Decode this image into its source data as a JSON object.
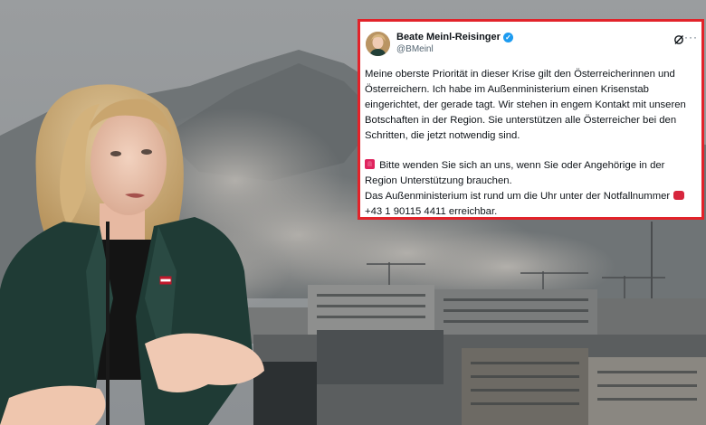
{
  "tweet": {
    "author_name": "Beate Meinl-Reisinger",
    "handle": "@BMeinl",
    "paragraph_1": "Meine oberste Priorität in dieser Krise gilt den Österreicherinnen und Österreichern. Ich habe im Außenministerium einen Krisenstab eingerichtet, der gerade tagt. Wir stehen in engem Kontakt mit unseren Botschaften in der Region. Sie unterstützen alle Österreicher bei den Schritten, die jetzt notwendig sind.",
    "paragraph_2_line_1": "Bitte wenden Sie sich an uns, wenn Sie oder Angehörige in der Region Unterstützung brauchen.",
    "paragraph_2_line_2": "Das Außenministerium ist rund um die Uhr unter der Notfallnummer",
    "phone_number": "+43 1 90115 4411 erreichbar.",
    "more_glyph": "···",
    "verified_glyph": "✓"
  },
  "colors": {
    "frame_red": "#e2232a",
    "verified_blue": "#1d9bf0",
    "blazer_green": "#1f3b35"
  },
  "icons": [
    "verified-badge-icon",
    "grok-icon",
    "more-options-icon",
    "siren-emoji-icon",
    "telephone-emoji-icon"
  ]
}
